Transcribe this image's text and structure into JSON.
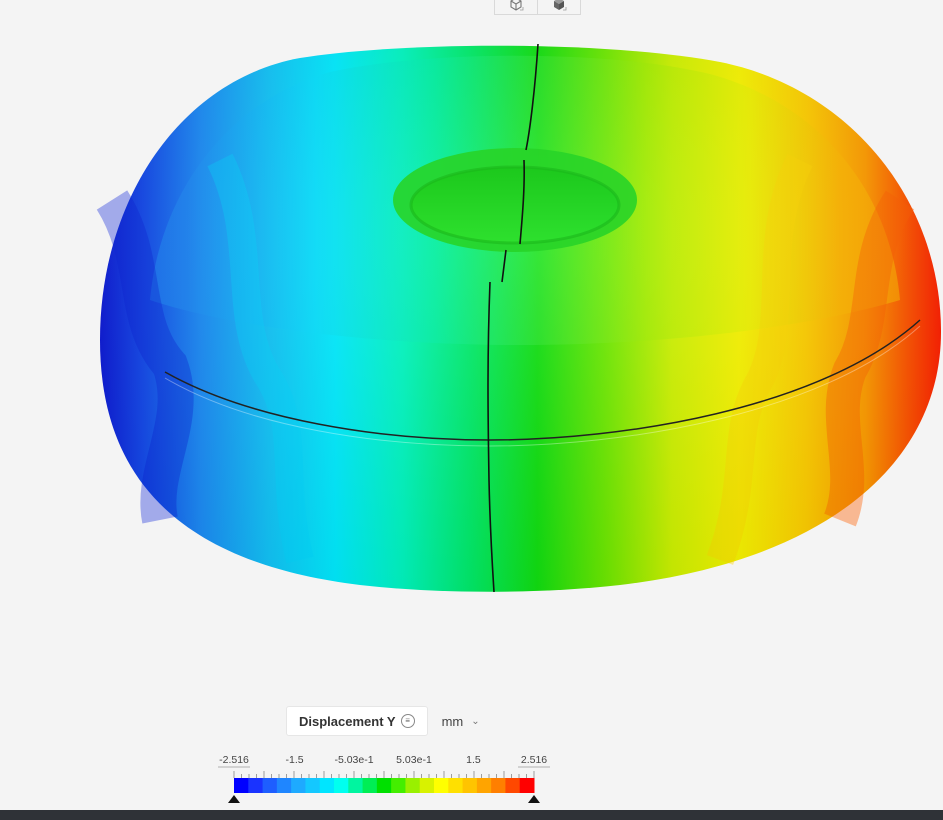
{
  "toolbar": {
    "view_buttons": [
      {
        "icon": "wireframe-cube-icon"
      },
      {
        "icon": "solid-cube-icon"
      }
    ]
  },
  "result": {
    "field_label": "Displacement Y",
    "field_menu_icon": "list-menu-icon",
    "unit": "mm",
    "unit_icon": "chevron-down-icon"
  },
  "legend": {
    "min": -2.516,
    "max": 2.516,
    "tick_labels": [
      "-2.516",
      "-1.5",
      "-5.03e-1",
      "5.03e-1",
      "1.5",
      "2.516"
    ],
    "colors": [
      "#0000ff",
      "#1a33ff",
      "#1e5eff",
      "#1f86ff",
      "#1eaaff",
      "#14c8ff",
      "#00e5ff",
      "#00fff0",
      "#00f5a0",
      "#00ee55",
      "#00e000",
      "#44ee00",
      "#99f000",
      "#d8f200",
      "#ffff00",
      "#ffe000",
      "#ffc400",
      "#ffa400",
      "#ff7f00",
      "#ff4800",
      "#ff0000"
    ]
  }
}
